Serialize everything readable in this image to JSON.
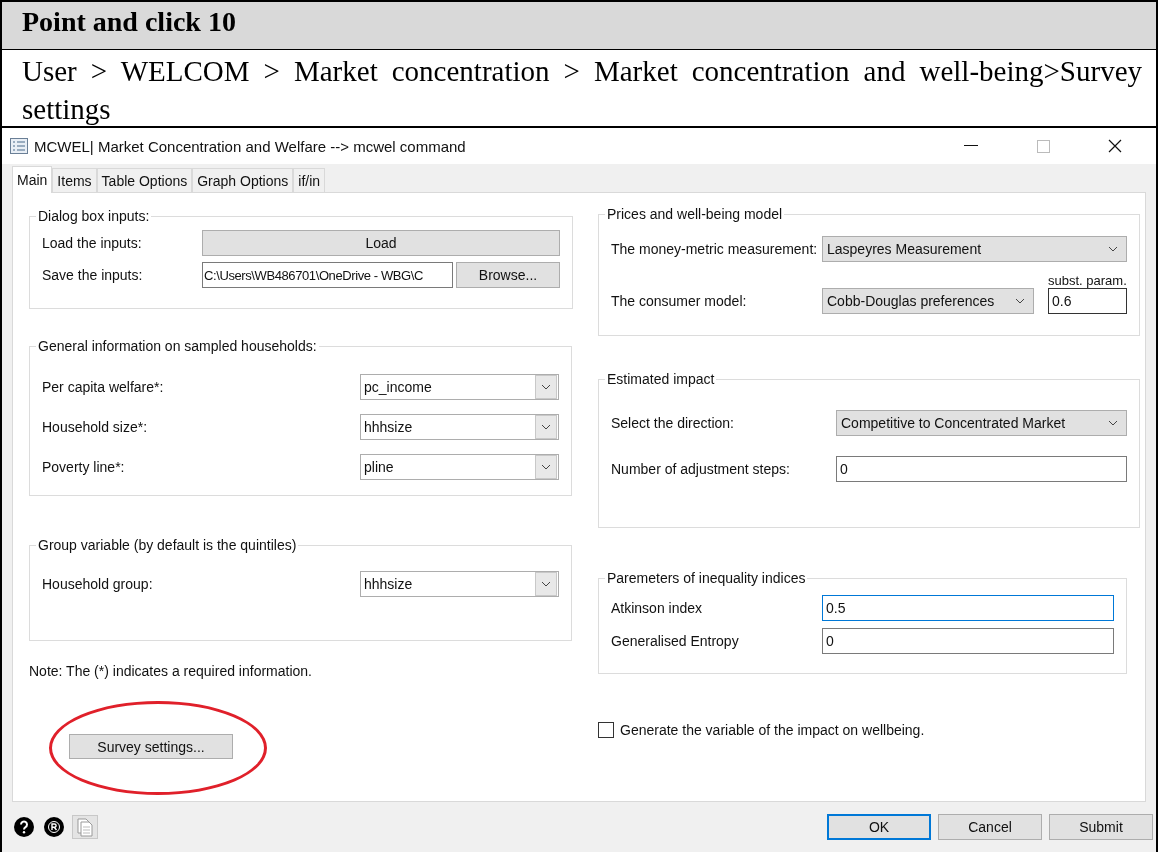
{
  "header": {
    "title": "Point and click 10",
    "breadcrumb": "User > WELCOM > Market concentration > Market concentration and well-being>Survey settings"
  },
  "window": {
    "title": "MCWEL| Market Concentration and Welfare --> mcwel command"
  },
  "tabs": [
    {
      "label": "Main",
      "selected": true
    },
    {
      "label": "Items",
      "selected": false
    },
    {
      "label": "Table Options",
      "selected": false
    },
    {
      "label": "Graph Options",
      "selected": false
    },
    {
      "label": "if/in",
      "selected": false
    }
  ],
  "left_groups": [
    {
      "legend": "Dialog box inputs:",
      "rows": [
        {
          "kind": "button",
          "label": "Load the inputs:",
          "value": "Load"
        },
        {
          "kind": "file",
          "label": "Save the inputs:",
          "value": "C:\\Users\\WB486701\\OneDrive - WBG\\C",
          "button": "Browse..."
        }
      ]
    },
    {
      "legend": "General information on sampled households:",
      "rows": [
        {
          "kind": "combo",
          "label": "Per capita welfare*:",
          "value": "pc_income"
        },
        {
          "kind": "combo",
          "label": "Household size*:",
          "value": "hhhsize"
        },
        {
          "kind": "combo",
          "label": "Poverty line*:",
          "value": "pline"
        }
      ]
    },
    {
      "legend": "Group variable (by default is the quintiles)",
      "rows": [
        {
          "kind": "combo",
          "label": "Household group:",
          "value": "hhhsize"
        }
      ]
    }
  ],
  "note": "Note: The (*) indicates a required information.",
  "survey_button": "Survey settings...",
  "right_groups": [
    {
      "legend": "Prices and well-being model",
      "rows": [
        {
          "kind": "select",
          "label": "The money-metric measurement:",
          "value": "Laspeyres Measurement"
        },
        {
          "kind": "select_param",
          "label": "The consumer model:",
          "value": "Cobb-Douglas preferences",
          "param_label": "subst. param.",
          "param_value": "0.6"
        }
      ]
    },
    {
      "legend": "Estimated impact",
      "rows": [
        {
          "kind": "select",
          "label": "Select the direction:",
          "value": "Competitive to Concentrated Market"
        },
        {
          "kind": "text",
          "label": "Number of adjustment steps:",
          "value": "0",
          "focused": false
        }
      ]
    },
    {
      "legend": "Paremeters of inequality indices",
      "rows": [
        {
          "kind": "text",
          "label": "Atkinson index",
          "value": "0.5",
          "focused": true
        },
        {
          "kind": "text",
          "label": "Generalised Entropy",
          "value": "0",
          "focused": false
        }
      ]
    }
  ],
  "checkbox": {
    "label": "Generate the variable of the impact on wellbeing.",
    "checked": false
  },
  "footer_buttons": [
    {
      "label": "OK",
      "default": true
    },
    {
      "label": "Cancel",
      "default": false
    },
    {
      "label": "Submit",
      "default": false
    }
  ]
}
